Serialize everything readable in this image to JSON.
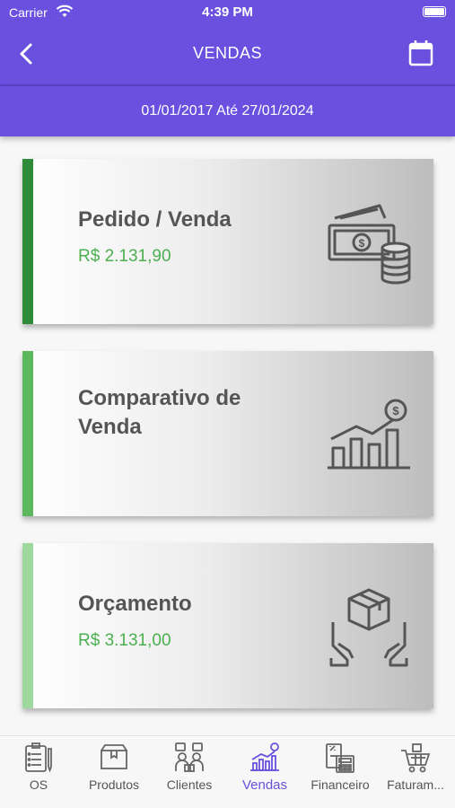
{
  "status": {
    "carrier": "Carrier",
    "time": "4:39 PM"
  },
  "header": {
    "title": "VENDAS",
    "date_range": "01/01/2017 Até 27/01/2024"
  },
  "cards": [
    {
      "title_line1": "Pedido / Venda",
      "title_line2": "",
      "value": "R$ 2.131,90",
      "icon": "money-icon",
      "accent": "#2e8b3a"
    },
    {
      "title_line1": "Comparativo de",
      "title_line2": "Venda",
      "value": "",
      "icon": "chart-growth-icon",
      "accent": "#5cb85c"
    },
    {
      "title_line1": "Orçamento",
      "title_line2": "",
      "value": "R$ 3.131,00",
      "icon": "box-hands-icon",
      "accent": "#9fd89f"
    }
  ],
  "tabs": [
    {
      "label": "OS",
      "icon": "clipboard-icon"
    },
    {
      "label": "Produtos",
      "icon": "box-icon"
    },
    {
      "label": "Clientes",
      "icon": "people-icon"
    },
    {
      "label": "Vendas",
      "icon": "sales-chart-icon",
      "active": true
    },
    {
      "label": "Financeiro",
      "icon": "calculator-icon"
    },
    {
      "label": "Faturam...",
      "icon": "cart-icon"
    }
  ],
  "colors": {
    "primary": "#6a50de",
    "value_green": "#4caf50"
  }
}
